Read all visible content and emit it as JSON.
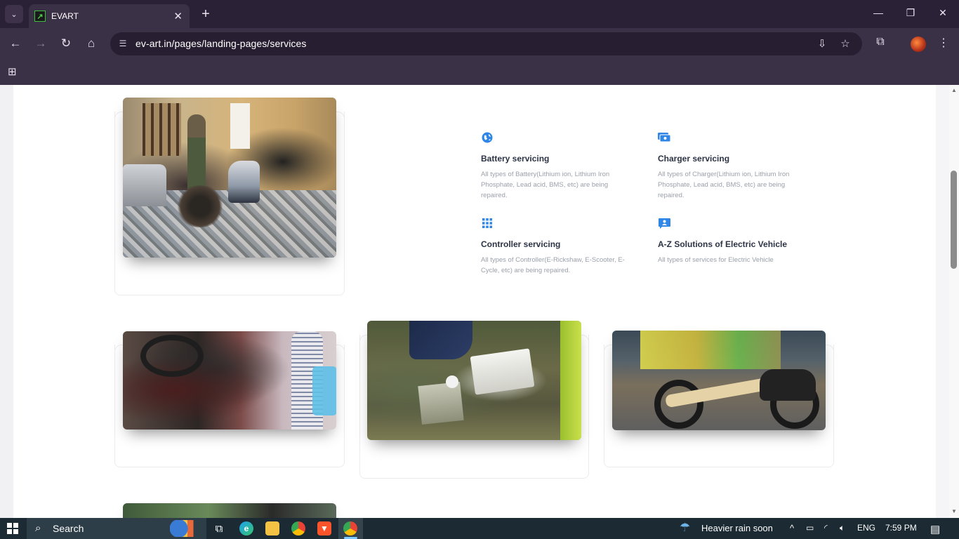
{
  "browser": {
    "tab_title": "EVART",
    "tab_favicon_letter": "↗",
    "url": "ev-art.in/pages/landing-pages/services"
  },
  "services": [
    {
      "icon": "globe-icon",
      "title": "Battery servicing",
      "description": "All types of Battery(Lithium ion, Lithium Iron Phosphate, Lead acid, BMS, etc) are being repaired."
    },
    {
      "icon": "payment-icon",
      "title": "Charger servicing",
      "description": "All types of Charger(Lithium ion, Lithium Iron Phosphate, Lead acid, BMS, etc) are being repaired."
    },
    {
      "icon": "grid-icon",
      "title": "Controller servicing",
      "description": "All types of Controller(E-Rickshaw, E-Scooter, E-Cycle, etc) are being repaired."
    },
    {
      "icon": "contact-card-icon",
      "title": "A-Z Solutions of Electric Vehicle",
      "description": "All types of services for Electric Vehicle"
    }
  ],
  "taskbar": {
    "search_label": "Search",
    "weather": "Heavier rain soon",
    "language": "ENG",
    "time": "7:59 PM"
  },
  "colors": {
    "chrome_dark": "#2b2137",
    "chrome_toolbar": "#3b3146",
    "service_icon": "#2f86e6",
    "service_title": "#2c3345",
    "service_desc": "#9aa0ab",
    "taskbar": "#1b2a33"
  }
}
